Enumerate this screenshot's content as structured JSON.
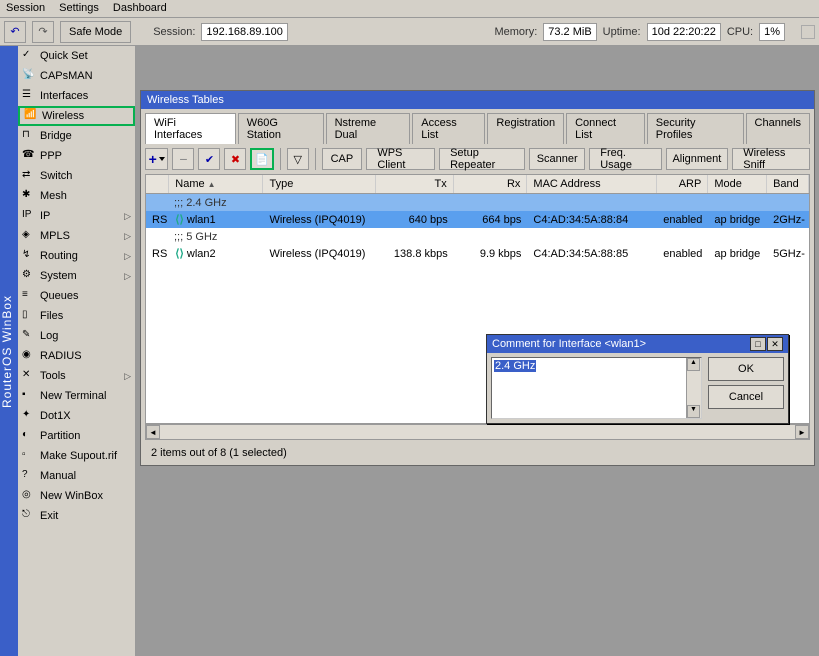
{
  "menu": {
    "session": "Session",
    "settings": "Settings",
    "dashboard": "Dashboard"
  },
  "toolbar": {
    "undo": "↶",
    "redo": "↷",
    "safe": "Safe Mode",
    "sessionLbl": "Session:",
    "session": "192.168.89.100",
    "memLbl": "Memory:",
    "mem": "73.2 MiB",
    "upLbl": "Uptime:",
    "up": "10d 22:20:22",
    "cpuLbl": "CPU:",
    "cpu": "1%"
  },
  "sideTitle": "RouterOS WinBox",
  "sidebar": [
    {
      "label": "Quick Set",
      "ic": "✓"
    },
    {
      "label": "CAPsMAN",
      "ic": "📡"
    },
    {
      "label": "Interfaces",
      "ic": "☰"
    },
    {
      "label": "Wireless",
      "ic": "📶",
      "hl": true
    },
    {
      "label": "Bridge",
      "ic": "⊓"
    },
    {
      "label": "PPP",
      "ic": "☎"
    },
    {
      "label": "Switch",
      "ic": "⇄"
    },
    {
      "label": "Mesh",
      "ic": "✱"
    },
    {
      "label": "IP",
      "ic": "IP",
      "chev": true
    },
    {
      "label": "MPLS",
      "ic": "◈",
      "chev": true
    },
    {
      "label": "Routing",
      "ic": "↯",
      "chev": true
    },
    {
      "label": "System",
      "ic": "⚙",
      "chev": true
    },
    {
      "label": "Queues",
      "ic": "≡"
    },
    {
      "label": "Files",
      "ic": "▯"
    },
    {
      "label": "Log",
      "ic": "✎"
    },
    {
      "label": "RADIUS",
      "ic": "◉"
    },
    {
      "label": "Tools",
      "ic": "✕",
      "chev": true
    },
    {
      "label": "New Terminal",
      "ic": "▪"
    },
    {
      "label": "Dot1X",
      "ic": "✦"
    },
    {
      "label": "Partition",
      "ic": "◐"
    },
    {
      "label": "Make Supout.rif",
      "ic": "▫"
    },
    {
      "label": "Manual",
      "ic": "?"
    },
    {
      "label": "New WinBox",
      "ic": "◎"
    },
    {
      "label": "Exit",
      "ic": "⎋"
    }
  ],
  "win": {
    "title": "Wireless Tables"
  },
  "tabs": [
    "WiFi Interfaces",
    "W60G Station",
    "Nstreme Dual",
    "Access List",
    "Registration",
    "Connect List",
    "Security Profiles",
    "Channels"
  ],
  "activeTab": 0,
  "wtb": {
    "add": "+",
    "rem": "−",
    "en": "✔",
    "dis": "✖",
    "cmt": "📄",
    "filt": "▽",
    "cap": "CAP",
    "wps": "WPS Client",
    "setup": "Setup Repeater",
    "scan": "Scanner",
    "freq": "Freq. Usage",
    "align": "Alignment",
    "sniff": "Wireless Sniff"
  },
  "cols": [
    "",
    "Name",
    "Type",
    "Tx",
    "Rx",
    "MAC Address",
    "ARP",
    "Mode",
    "Band"
  ],
  "groups": [
    {
      "label": ";;; 2.4 GHz",
      "selhdr": true,
      "rows": [
        {
          "flag": "RS",
          "name": "wlan1",
          "type": "Wireless (IPQ4019)",
          "tx": "640 bps",
          "rx": "664 bps",
          "mac": "C4:AD:34:5A:88:84",
          "arp": "enabled",
          "mode": "ap bridge",
          "band": "2GHz-",
          "sel": true
        }
      ]
    },
    {
      "label": ";;; 5 GHz",
      "rows": [
        {
          "flag": "RS",
          "name": "wlan2",
          "type": "Wireless (IPQ4019)",
          "tx": "138.8 kbps",
          "rx": "9.9 kbps",
          "mac": "C4:AD:34:5A:88:85",
          "arp": "enabled",
          "mode": "ap bridge",
          "band": "5GHz-"
        }
      ]
    }
  ],
  "status": "2 items out of 8 (1 selected)",
  "dialog": {
    "title": "Comment for Interface <wlan1>",
    "text": "2.4 GHz",
    "ok": "OK",
    "cancel": "Cancel"
  }
}
